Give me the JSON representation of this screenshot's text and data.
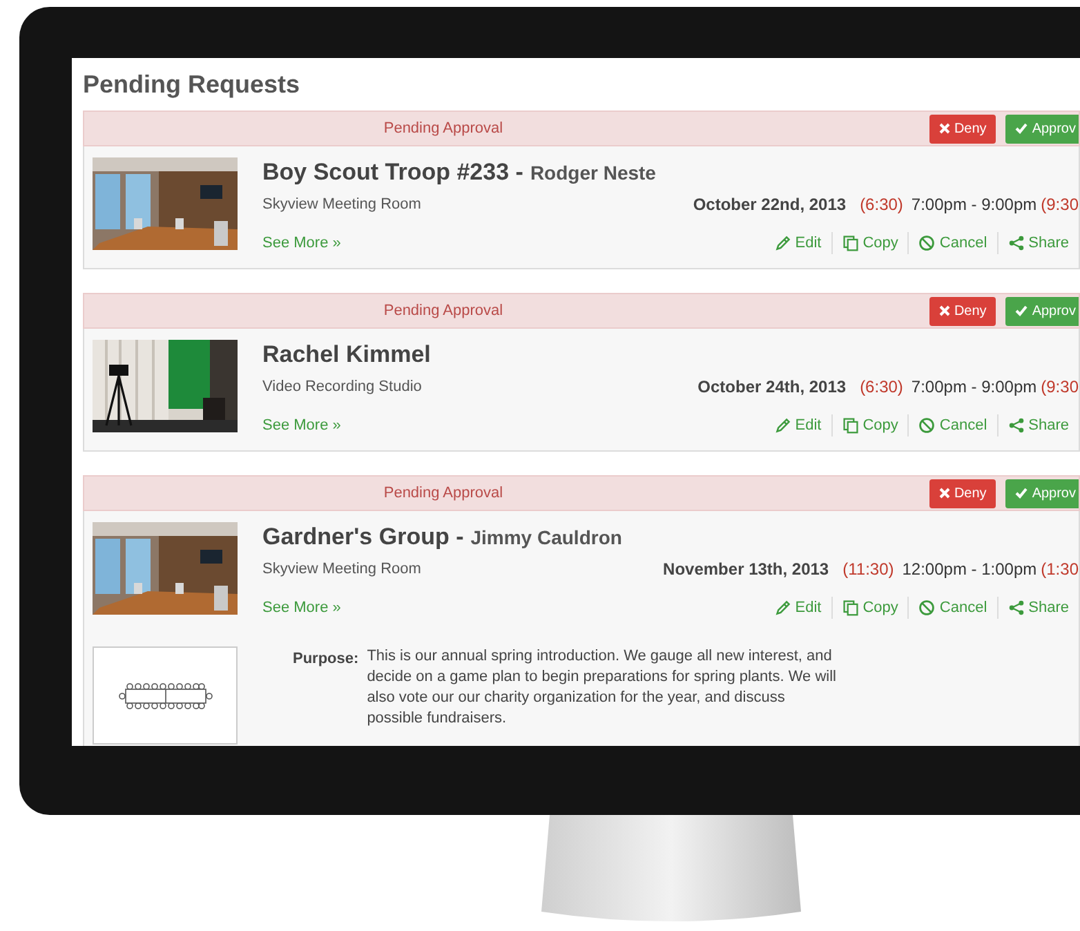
{
  "page": {
    "title": "Pending Requests"
  },
  "requests": [
    {
      "status": "Pending Approval",
      "deny": "Deny",
      "approve": "Approv",
      "title": "Boy Scout Troop #233 -",
      "contact": "Rodger Neste",
      "room": "Skyview Meeting Room",
      "see_more": "See More »",
      "date": "October 22nd, 2013",
      "setup": "(6:30)",
      "time": "7:00pm - 9:00pm",
      "teardown": "(9:30",
      "actions": [
        {
          "kind": "edit",
          "label": "Edit"
        },
        {
          "kind": "copy",
          "label": "Copy"
        },
        {
          "kind": "cancel",
          "label": "Cancel"
        },
        {
          "kind": "share",
          "label": "Share"
        }
      ]
    },
    {
      "status": "Pending Approval",
      "deny": "Deny",
      "approve": "Approv",
      "title": "Rachel Kimmel",
      "room": "Video Recording Studio",
      "see_more": "See More »",
      "date": "October 24th, 2013",
      "setup": "(6:30)",
      "time": "7:00pm - 9:00pm",
      "teardown": "(9:30",
      "actions": [
        {
          "kind": "edit",
          "label": "Edit"
        },
        {
          "kind": "copy",
          "label": "Copy"
        },
        {
          "kind": "cancel",
          "label": "Cancel"
        },
        {
          "kind": "share",
          "label": "Share"
        }
      ]
    },
    {
      "status": "Pending Approval",
      "deny": "Deny",
      "approve": "Approv",
      "title": "Gardner's Group -",
      "contact": "Jimmy Cauldron",
      "room": "Skyview Meeting Room",
      "see_more": "See More »",
      "date": "November 13th, 2013",
      "setup": "(11:30)",
      "time": "12:00pm - 1:00pm",
      "teardown": "(1:30",
      "actions": [
        {
          "kind": "edit",
          "label": "Edit"
        },
        {
          "kind": "copy",
          "label": "Copy"
        },
        {
          "kind": "cancel",
          "label": "Cancel"
        },
        {
          "kind": "share",
          "label": "Share"
        }
      ],
      "purpose": {
        "label": "Purpose:",
        "text": "This is our annual spring introduction. We gauge all new interest, and decide on a game plan to begin preparations for spring plants. We will also vote our our charity organization for the year, and discuss possible fundraisers."
      }
    }
  ]
}
